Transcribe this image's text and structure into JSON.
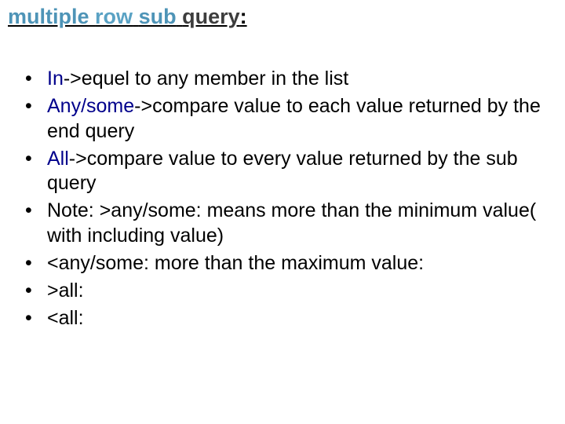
{
  "title": {
    "w1": "multiple",
    "w2": "row",
    "w3": "sub",
    "w4": "query",
    "colon": ":"
  },
  "bullets": {
    "b1": {
      "kw": "In",
      "rest": "->equel to any member in the list"
    },
    "b2": {
      "kw": "Any/some",
      "rest": "->compare value to each value returned by the end query"
    },
    "b3": {
      "kw": "All",
      "rest": "->compare value to every value returned by the sub query"
    },
    "b4": {
      "text": "Note: >any/some: means more than the minimum value( with including value)"
    },
    "b5": {
      "text": "<any/some: more than the maximum value:"
    },
    "b6": {
      "text": ">all:"
    },
    "b7": {
      "text": "<all:"
    }
  }
}
